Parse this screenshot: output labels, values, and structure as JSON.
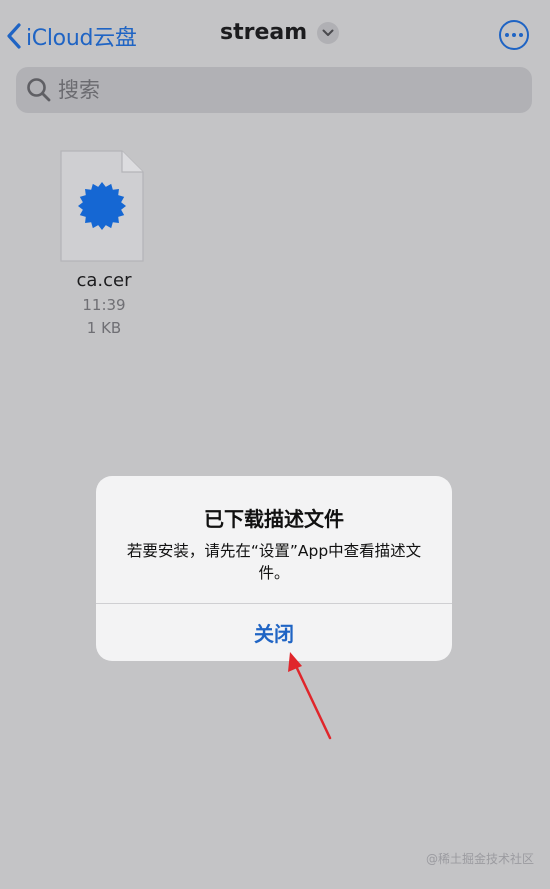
{
  "nav": {
    "back_label": "iCloud云盘",
    "title": "stream"
  },
  "search": {
    "placeholder": "搜索"
  },
  "file": {
    "name": "ca.cer",
    "time": "11:39",
    "size": "1 KB"
  },
  "alert": {
    "title": "已下载描述文件",
    "message": "若要安装，请先在“设置”App中查看描述文件。",
    "button_label": "关闭"
  },
  "watermark": "@稀土掘金技术社区",
  "colors": {
    "accent": "#1f64c4",
    "background": "#c4c4c6",
    "annotation_arrow": "#e0262b"
  },
  "icons": [
    "chevron-left-icon",
    "chevron-down-icon",
    "more-icon",
    "search-icon",
    "certificate-seal-icon"
  ]
}
